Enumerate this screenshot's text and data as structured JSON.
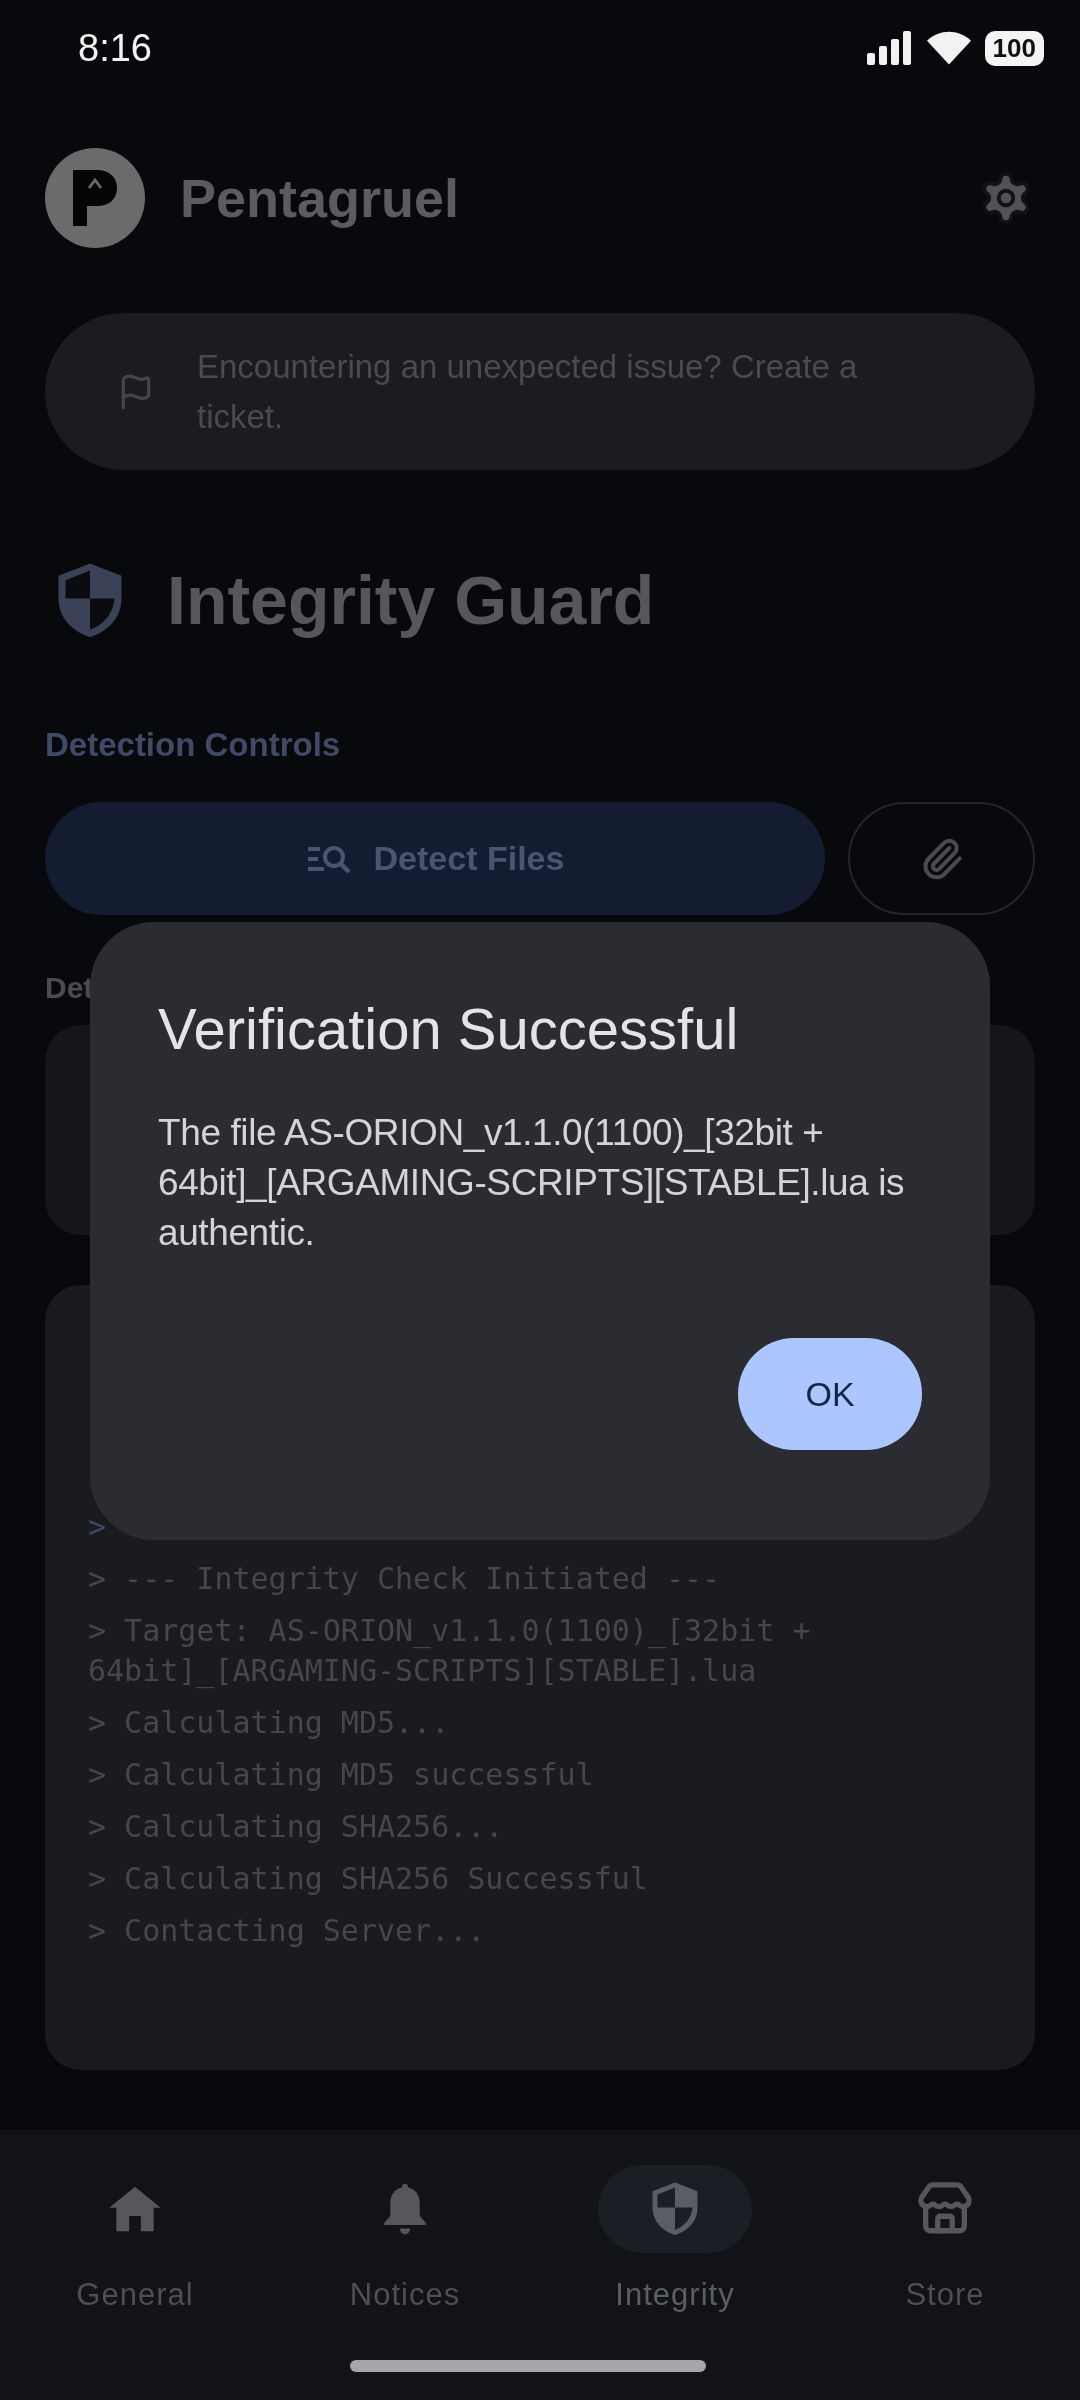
{
  "status_bar": {
    "time": "8:16",
    "battery": "100"
  },
  "header": {
    "title": "Pentagruel"
  },
  "ticket_banner": {
    "text": "Encountering an unexpected issue? Create a ticket."
  },
  "page_title": "Integrity Guard",
  "detection_controls": {
    "label": "Detection Controls",
    "detect_button": "Detect Files"
  },
  "section_label": "Det",
  "log": {
    "lines": [
      ">",
      "> --- Integrity Check Initiated ---",
      "> Target: AS-ORION_v1.1.0(1100)_[32bit + 64bit]_[ARGAMING-SCRIPTS][STABLE].lua",
      "> Calculating MD5...",
      "> Calculating MD5 successful",
      "> Calculating SHA256...",
      "> Calculating SHA256 Successful",
      "> Contacting Server..."
    ]
  },
  "dialog": {
    "title": "Verification Successful",
    "message": "The file AS-ORION_v1.1.0(1100)_[32bit + 64bit]_[ARGAMING-SCRIPTS][STABLE].lua is authentic.",
    "button": "OK"
  },
  "bottom_nav": [
    {
      "kind": "home",
      "label": "General",
      "selected": false
    },
    {
      "kind": "bell",
      "label": "Notices",
      "selected": false
    },
    {
      "kind": "shield",
      "label": "Integrity",
      "selected": true
    },
    {
      "kind": "store",
      "label": "Store",
      "selected": false
    }
  ]
}
